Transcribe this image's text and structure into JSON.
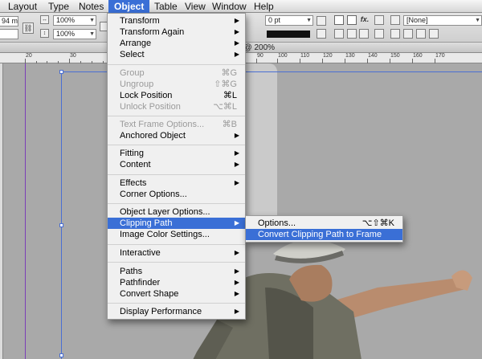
{
  "menubar": {
    "items": [
      {
        "label": "Layout",
        "active": false
      },
      {
        "label": "Type",
        "active": false
      },
      {
        "label": "Notes",
        "active": false
      },
      {
        "label": "Object",
        "active": true
      },
      {
        "label": "Table",
        "active": false
      },
      {
        "label": "View",
        "active": false
      },
      {
        "label": "Window",
        "active": false
      },
      {
        "label": "Help",
        "active": false
      }
    ]
  },
  "control_panel": {
    "width_value": "94 mm",
    "scale_x": "100%",
    "scale_y": "100%",
    "stroke_weight": "0 pt",
    "object_style": "[None]"
  },
  "document": {
    "title": "Untitled-1 @ 200%"
  },
  "ruler": {
    "labels": [
      "20",
      "30",
      "90",
      "100",
      "110",
      "120",
      "130",
      "140",
      "150",
      "160",
      "170"
    ]
  },
  "object_menu": {
    "items": [
      {
        "label": "Transform",
        "shortcut": "",
        "submenu": true,
        "disabled": false
      },
      {
        "label": "Transform Again",
        "shortcut": "",
        "submenu": true,
        "disabled": false
      },
      {
        "label": "Arrange",
        "shortcut": "",
        "submenu": true,
        "disabled": false
      },
      {
        "label": "Select",
        "shortcut": "",
        "submenu": true,
        "disabled": false
      },
      {
        "separator": true
      },
      {
        "label": "Group",
        "shortcut": "⌘G",
        "submenu": false,
        "disabled": true
      },
      {
        "label": "Ungroup",
        "shortcut": "⇧⌘G",
        "submenu": false,
        "disabled": true
      },
      {
        "label": "Lock Position",
        "shortcut": "⌘L",
        "submenu": false,
        "disabled": false
      },
      {
        "label": "Unlock Position",
        "shortcut": "⌥⌘L",
        "submenu": false,
        "disabled": true
      },
      {
        "separator": true
      },
      {
        "label": "Text Frame Options...",
        "shortcut": "⌘B",
        "submenu": false,
        "disabled": true
      },
      {
        "label": "Anchored Object",
        "shortcut": "",
        "submenu": true,
        "disabled": false
      },
      {
        "separator": true
      },
      {
        "label": "Fitting",
        "shortcut": "",
        "submenu": true,
        "disabled": false
      },
      {
        "label": "Content",
        "shortcut": "",
        "submenu": true,
        "disabled": false
      },
      {
        "separator": true
      },
      {
        "label": "Effects",
        "shortcut": "",
        "submenu": true,
        "disabled": false
      },
      {
        "label": "Corner Options...",
        "shortcut": "",
        "submenu": false,
        "disabled": false
      },
      {
        "separator": true
      },
      {
        "label": "Object Layer Options...",
        "shortcut": "",
        "submenu": false,
        "disabled": false
      },
      {
        "label": "Clipping Path",
        "shortcut": "",
        "submenu": true,
        "disabled": false,
        "highlighted": true
      },
      {
        "label": "Image Color Settings...",
        "shortcut": "",
        "submenu": false,
        "disabled": false
      },
      {
        "separator": true
      },
      {
        "label": "Interactive",
        "shortcut": "",
        "submenu": true,
        "disabled": false
      },
      {
        "separator": true
      },
      {
        "label": "Paths",
        "shortcut": "",
        "submenu": true,
        "disabled": false
      },
      {
        "label": "Pathfinder",
        "shortcut": "",
        "submenu": true,
        "disabled": false
      },
      {
        "label": "Convert Shape",
        "shortcut": "",
        "submenu": true,
        "disabled": false
      },
      {
        "separator": true
      },
      {
        "label": "Display Performance",
        "shortcut": "",
        "submenu": true,
        "disabled": false
      }
    ]
  },
  "clipping_submenu": {
    "items": [
      {
        "label": "Options...",
        "shortcut": "⌥⇧⌘K",
        "highlighted": false
      },
      {
        "label": "Convert Clipping Path to Frame",
        "shortcut": "",
        "highlighted": true
      }
    ]
  },
  "colors": {
    "accent": "#3a6fd6",
    "frame": "#4a6fd3",
    "page_edge": "#7b3fb7"
  }
}
